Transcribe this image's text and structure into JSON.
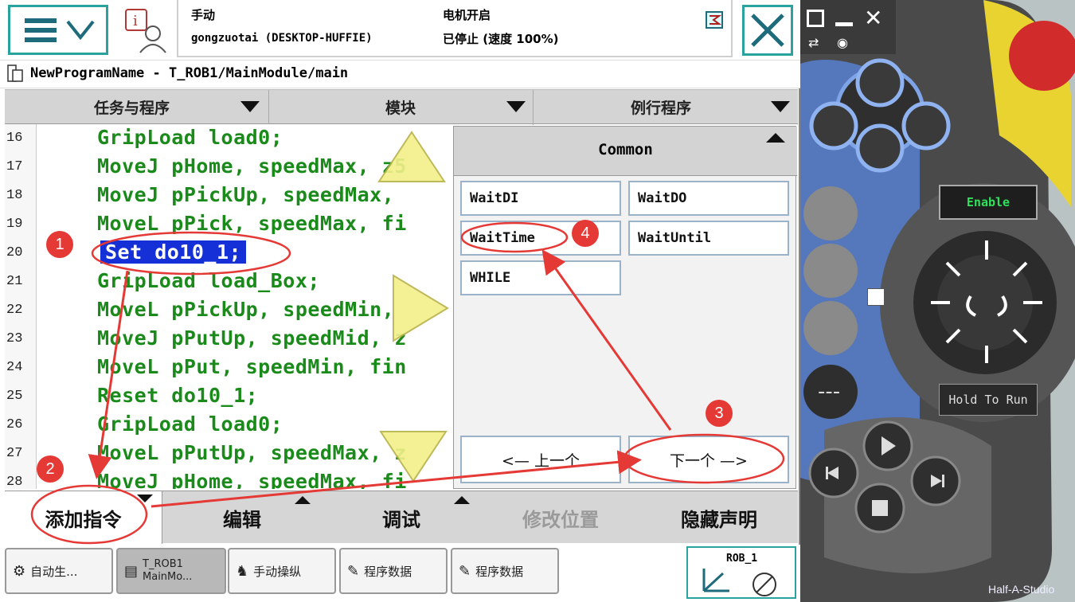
{
  "status": {
    "mode": "手动",
    "controller": "gongzuotai (DESKTOP-HUFFIE)",
    "motor": "电机开启",
    "state": "已停止 (速度 100%)"
  },
  "path": "NewProgramName - T_ROB1/MainModule/main",
  "tabs": [
    "任务与程序",
    "模块",
    "例行程序"
  ],
  "code": {
    "line_numbers": [
      "16",
      "17",
      "18",
      "19",
      "20",
      "21",
      "22",
      "23",
      "24",
      "25",
      "26",
      "27",
      "28"
    ],
    "lines": [
      "GripLoad load0;",
      "MoveJ pHome, speedMax, z5",
      "MoveJ pPickUp, speedMax,",
      "MoveL pPick, speedMax, fi",
      "Set do10_1;",
      "GripLoad load_Box;",
      "MoveL pPickUp, speedMin,",
      "MoveJ pPutUp, speedMid, z",
      "MoveL pPut, speedMin, fin",
      "Reset do10_1;",
      "GripLoad load0;",
      "MoveL pPutUp, speedMax, z",
      "MoveJ pHome, speedMax, fi"
    ]
  },
  "picker": {
    "title": "Common",
    "items": [
      "WaitDI",
      "WaitDO",
      "WaitTime",
      "WaitUntil",
      "WHILE"
    ],
    "prev": "<—  上一个",
    "next": "下一个  —>"
  },
  "bottom_menu": [
    "添加指令",
    "编辑",
    "调试",
    "修改位置",
    "隐藏声明"
  ],
  "taskbar": {
    "items": [
      "自动生...",
      "T_ROB1 MainMo...",
      "手动操纵",
      "程序数据",
      "程序数据"
    ],
    "robot": "ROB_1"
  },
  "device": {
    "enable": "Enable",
    "hold": "Hold To Run",
    "watermark": "Half-A-Studio"
  },
  "annotations": [
    "1",
    "2",
    "3",
    "4"
  ],
  "colors": {
    "accent": "#2aa39e",
    "code": "#1a8a1a",
    "selection": "#1430d6",
    "annotation": "#e53935"
  }
}
